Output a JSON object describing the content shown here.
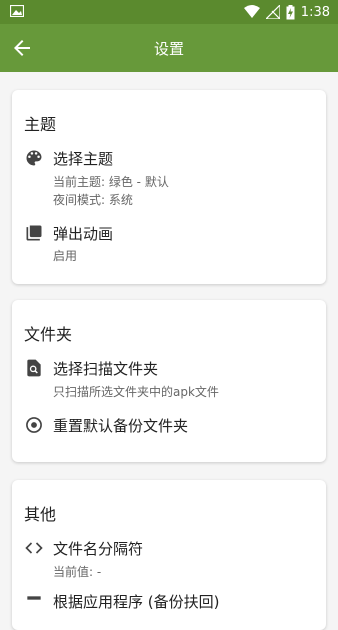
{
  "status_bar": {
    "time": "1:38"
  },
  "toolbar": {
    "title": "设置"
  },
  "sections": [
    {
      "title": "主题",
      "items": [
        {
          "icon": "palette-icon",
          "title": "选择主题",
          "subtitles": [
            "当前主题: 绿色 - 默认",
            "夜间模式: 系统"
          ]
        },
        {
          "icon": "popup-animation-icon",
          "title": "弹出动画",
          "subtitles": [
            "启用"
          ]
        }
      ]
    },
    {
      "title": "文件夹",
      "items": [
        {
          "icon": "scan-folder-icon",
          "title": "选择扫描文件夹",
          "subtitles": [
            "只扫描所选文件夹中的apk文件"
          ]
        },
        {
          "icon": "reset-icon",
          "title": "重置默认备份文件夹",
          "subtitles": []
        }
      ]
    },
    {
      "title": "其他",
      "items": [
        {
          "icon": "code-icon",
          "title": "文件名分隔符",
          "subtitles": [
            "当前值: -"
          ]
        },
        {
          "icon": "sort-icon",
          "title": "根据应用程序 (备份扶回)",
          "subtitles": []
        }
      ]
    }
  ]
}
